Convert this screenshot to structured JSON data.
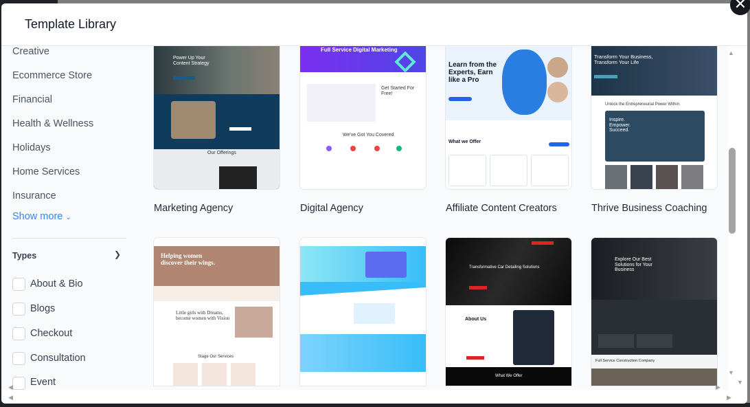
{
  "header": {
    "title": "Template Library",
    "close_icon": "close-icon"
  },
  "sidebar": {
    "categories": [
      "Creative",
      "Ecommerce Store",
      "Financial",
      "Health & Wellness",
      "Holidays",
      "Home Services",
      "Insurance"
    ],
    "show_more": "Show more",
    "types": {
      "title": "Types",
      "items": [
        "About & Bio",
        "Blogs",
        "Checkout",
        "Consultation",
        "Event"
      ]
    }
  },
  "templates": [
    {
      "name": "Marketing Agency",
      "thumb": {
        "t1": "Power Up Your Content Strategy",
        "t2": "Our Offerings"
      }
    },
    {
      "name": "Digital Agency",
      "thumb": {
        "t1": "Full Service Digital Marketing",
        "t2": "Get Started For Free!",
        "t3": "We've Got You Covered"
      }
    },
    {
      "name": "Affiliate Content Creators",
      "thumb": {
        "t1": "Learn from the Experts, Earn like a Pro",
        "t2": "What we Offer"
      }
    },
    {
      "name": "Thrive Business Coaching",
      "thumb": {
        "t1": "Transform Your Business, Transform Your Life",
        "t2": "Unlock the Entrepreneurial Power Within.",
        "t3": "Inspire. Empower. Succeed."
      }
    },
    {
      "name": "",
      "thumb": {
        "t1": "Helping women discover their wings.",
        "t2": "Little girls with Dreams, become women with Vision",
        "t3": "Stage Our Services"
      }
    },
    {
      "name": "",
      "thumb": {}
    },
    {
      "name": "",
      "thumb": {
        "t1": "Transformative Car Detailing Solutions",
        "t2": "About Us",
        "t3": "What We Offer"
      }
    },
    {
      "name": "",
      "thumb": {
        "t1": "Explore Our Best Solutions for Your Business",
        "t2": "Full Service Construction Company"
      }
    }
  ],
  "colors": {
    "accent": "#3b82f6",
    "sidebar_bg": "#f8fafc"
  }
}
